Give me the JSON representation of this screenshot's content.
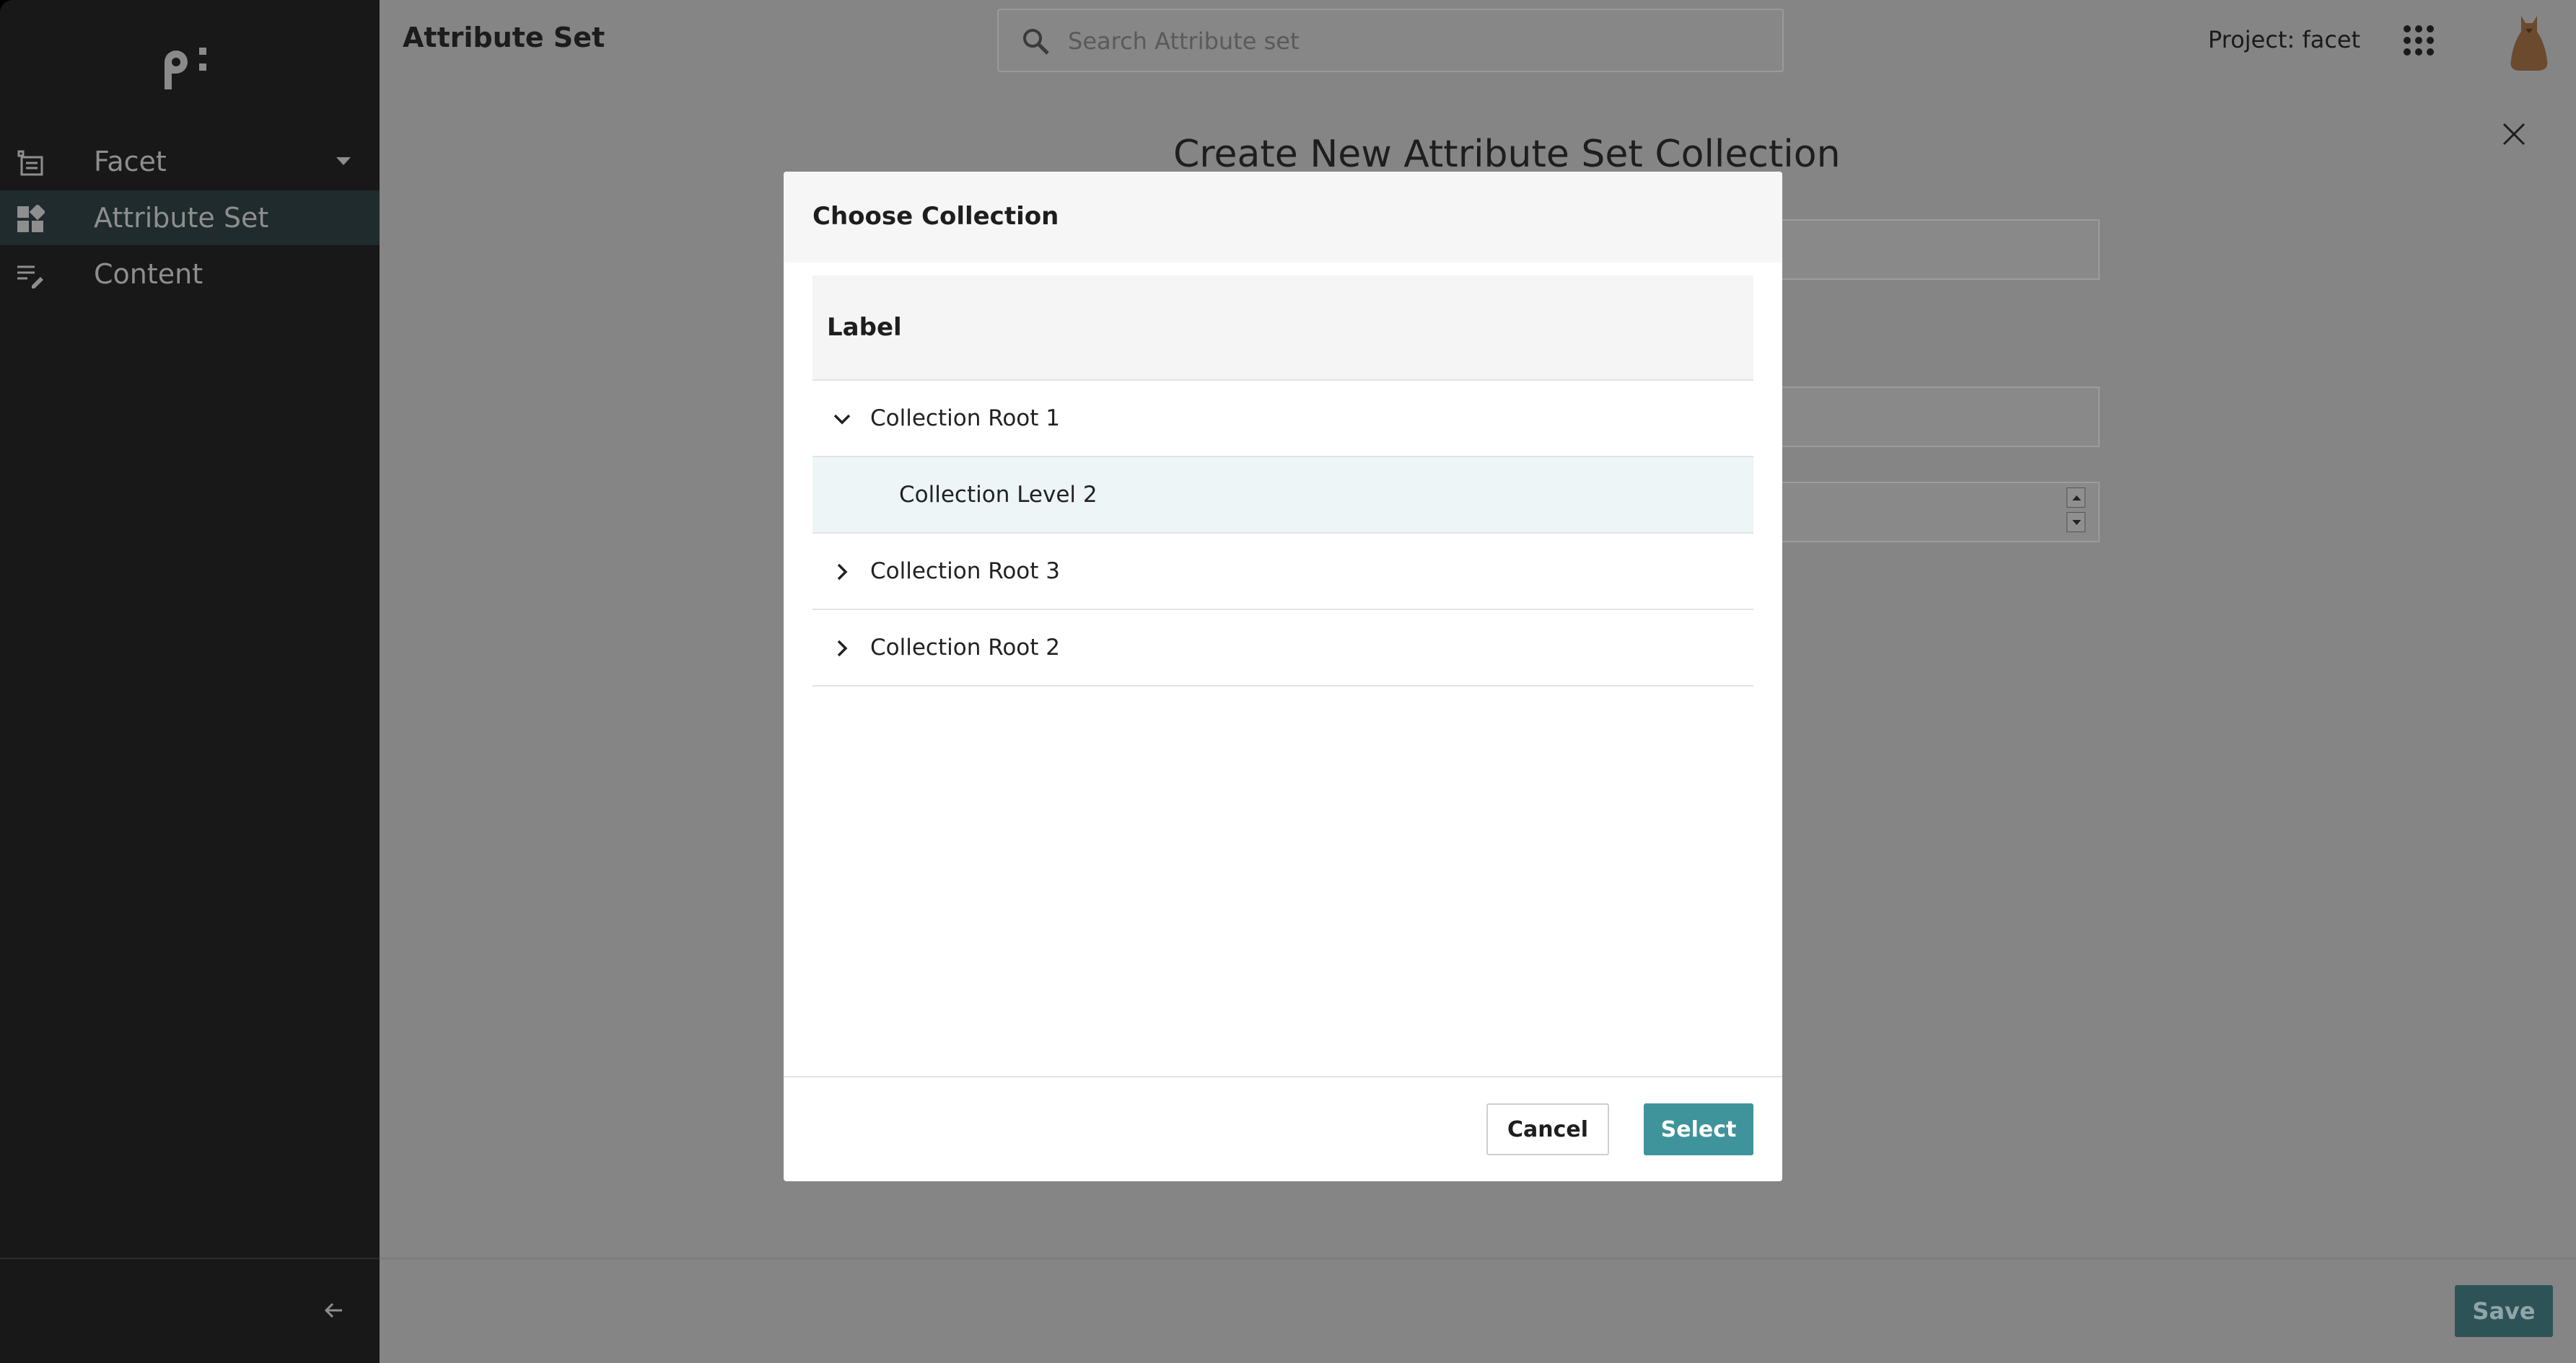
{
  "sidebar": {
    "items": [
      {
        "label": "Facet",
        "icon": "list-icon"
      },
      {
        "label": "Attribute Set",
        "icon": "dashboard-icon",
        "active": true
      },
      {
        "label": "Content",
        "icon": "edit-list-icon"
      }
    ]
  },
  "header": {
    "title": "Attribute Set",
    "search_placeholder": "Search Attribute set",
    "project": "Project: facet"
  },
  "main": {
    "heading": "Create New Attribute Set Collection"
  },
  "footer": {
    "save_label": "Save"
  },
  "modal": {
    "title": "Choose Collection",
    "column_header": "Label",
    "rows": [
      {
        "label": "Collection Root 1",
        "level": 1,
        "expanded": true
      },
      {
        "label": "Collection Level 2",
        "level": 2,
        "selected": true
      },
      {
        "label": "Collection Root 3",
        "level": 1,
        "expanded": false
      },
      {
        "label": "Collection Root 2",
        "level": 1,
        "expanded": false
      }
    ],
    "cancel_label": "Cancel",
    "select_label": "Select"
  },
  "colors": {
    "sidebar_bg": "#181818",
    "accent": "#3f939b",
    "overlay": "#858585"
  }
}
